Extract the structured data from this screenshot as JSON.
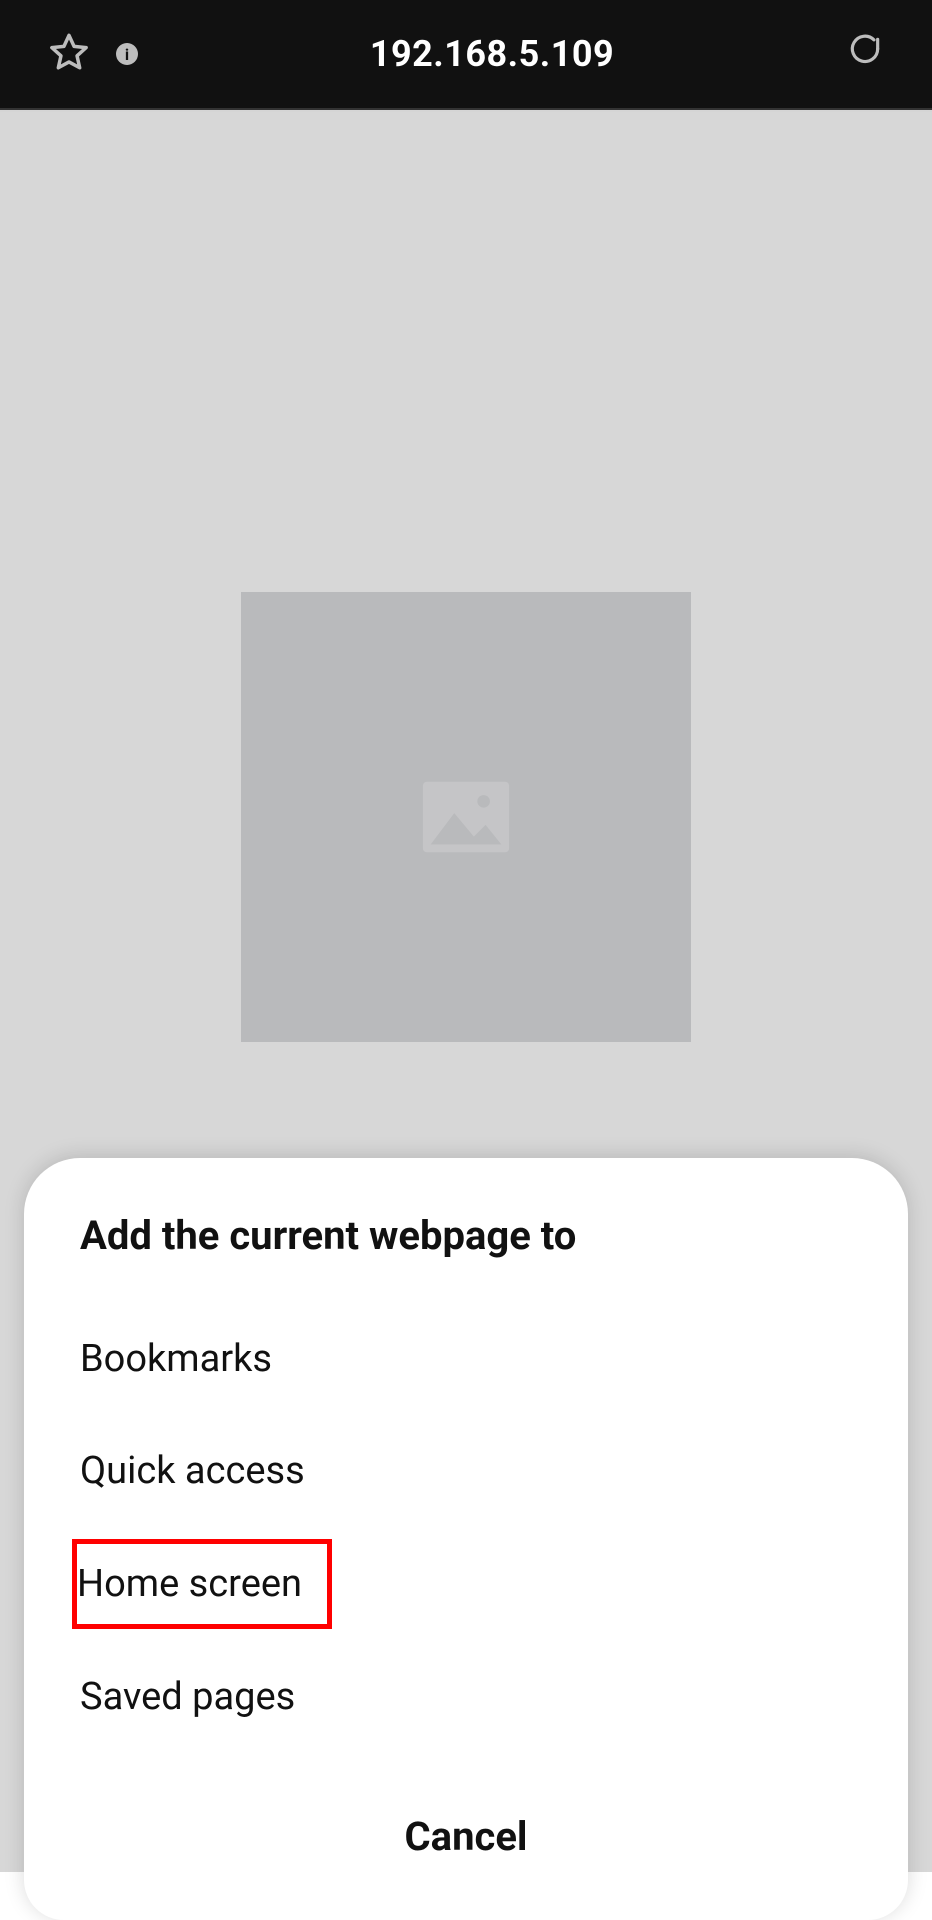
{
  "toolbar": {
    "address": "192.168.5.109"
  },
  "dialog": {
    "title": "Add the current webpage to",
    "options": [
      {
        "label": "Bookmarks",
        "highlighted": false
      },
      {
        "label": "Quick access",
        "highlighted": false
      },
      {
        "label": "Home screen",
        "highlighted": true
      },
      {
        "label": "Saved pages",
        "highlighted": false
      }
    ],
    "cancel_label": "Cancel"
  }
}
